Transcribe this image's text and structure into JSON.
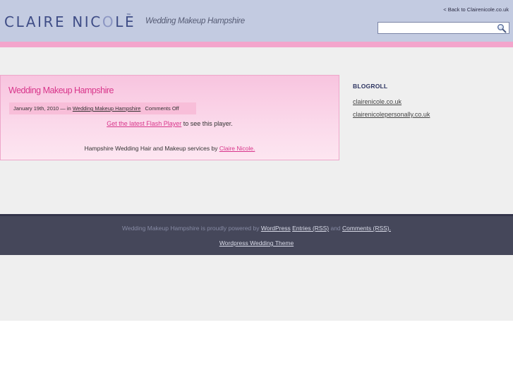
{
  "header": {
    "logo_text_a": "CLAIRE NIC",
    "logo_text_o": "O",
    "logo_text_b": "LE",
    "logo_tm": "™",
    "site_description": "Wedding Makeup Hampshire",
    "back_link": "< Back to Clairenicole.co.uk",
    "search": {
      "value": "",
      "placeholder": ""
    },
    "icons": {
      "search": "magnifier-icon"
    }
  },
  "post": {
    "title": "Wedding Makeup Hampshire",
    "meta_date": "January 19th, 2010 — in",
    "meta_category": "Wedding Makeup Hampshire",
    "meta_comments": "Comments Off",
    "flash_link": "Get the latest Flash Player",
    "flash_suffix": "to see this player.",
    "services_prefix": "Hampshire Wedding Hair and Makeup services by",
    "services_link": "Claire Nicole."
  },
  "sidebar": {
    "blogroll_title": "BLOGROLL",
    "links": [
      {
        "label": "clairenicole.co.uk"
      },
      {
        "label": "clairenicolepersonally.co.uk"
      }
    ]
  },
  "footer": {
    "powered_prefix": "Wedding Makeup Hampshire is proudly powered by",
    "wordpress_link": "WordPress",
    "entries_link": "Entries (RSS)",
    "and_text": "and",
    "comments_link": "Comments (RSS).",
    "theme_link": "Wordpress Wedding Theme"
  },
  "colors": {
    "header_bg": "#c3cbe1",
    "pink_band": "#f3a5cc",
    "accent_pink": "#d8368b",
    "logo_blue": "#3f4d86",
    "footer_bg": "#45475a",
    "page_bg": "#efefef"
  }
}
